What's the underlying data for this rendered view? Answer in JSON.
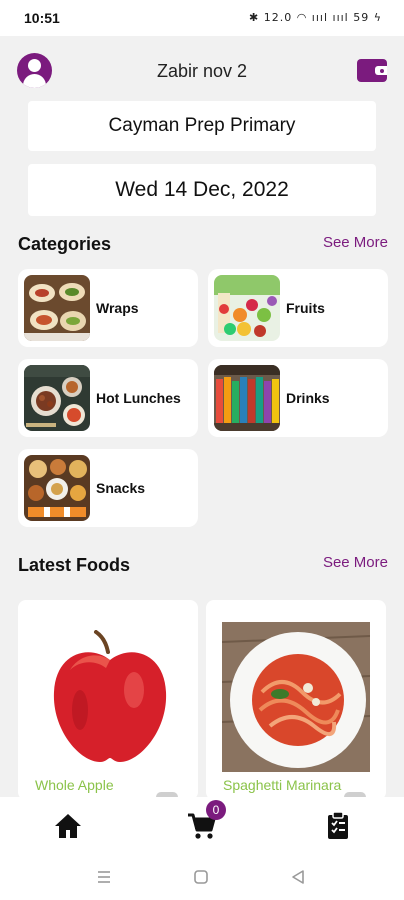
{
  "status_bar": {
    "time": "10:51",
    "icons": "✱ 12.0 ◠ ıııl ıııl 59 ϟ",
    "battery": "59"
  },
  "header": {
    "title": "Zabir nov 2"
  },
  "school": {
    "name": "Cayman Prep Primary"
  },
  "date": {
    "label": "Wed 14 Dec, 2022"
  },
  "categories": {
    "title": "Categories",
    "see_more": "See More",
    "items": [
      {
        "label": "Wraps"
      },
      {
        "label": "Fruits"
      },
      {
        "label": "Hot Lunches"
      },
      {
        "label": "Drinks"
      },
      {
        "label": "Snacks"
      }
    ]
  },
  "latest_foods": {
    "title": "Latest Foods",
    "see_more": "See More",
    "items": [
      {
        "name": "Whole Apple"
      },
      {
        "name": "Spaghetti Marinara"
      }
    ]
  },
  "bottom_nav": {
    "items": [
      {
        "icon": "home-icon"
      },
      {
        "icon": "cart-icon",
        "badge": "0"
      },
      {
        "icon": "clipboard-icon"
      }
    ]
  },
  "system_nav": {
    "icons": [
      "recents-icon",
      "home-square-icon",
      "back-triangle-icon"
    ]
  },
  "colors": {
    "accent": "#7b1b7e",
    "food_name": "#8bc34a",
    "background": "#f1f1f1"
  }
}
